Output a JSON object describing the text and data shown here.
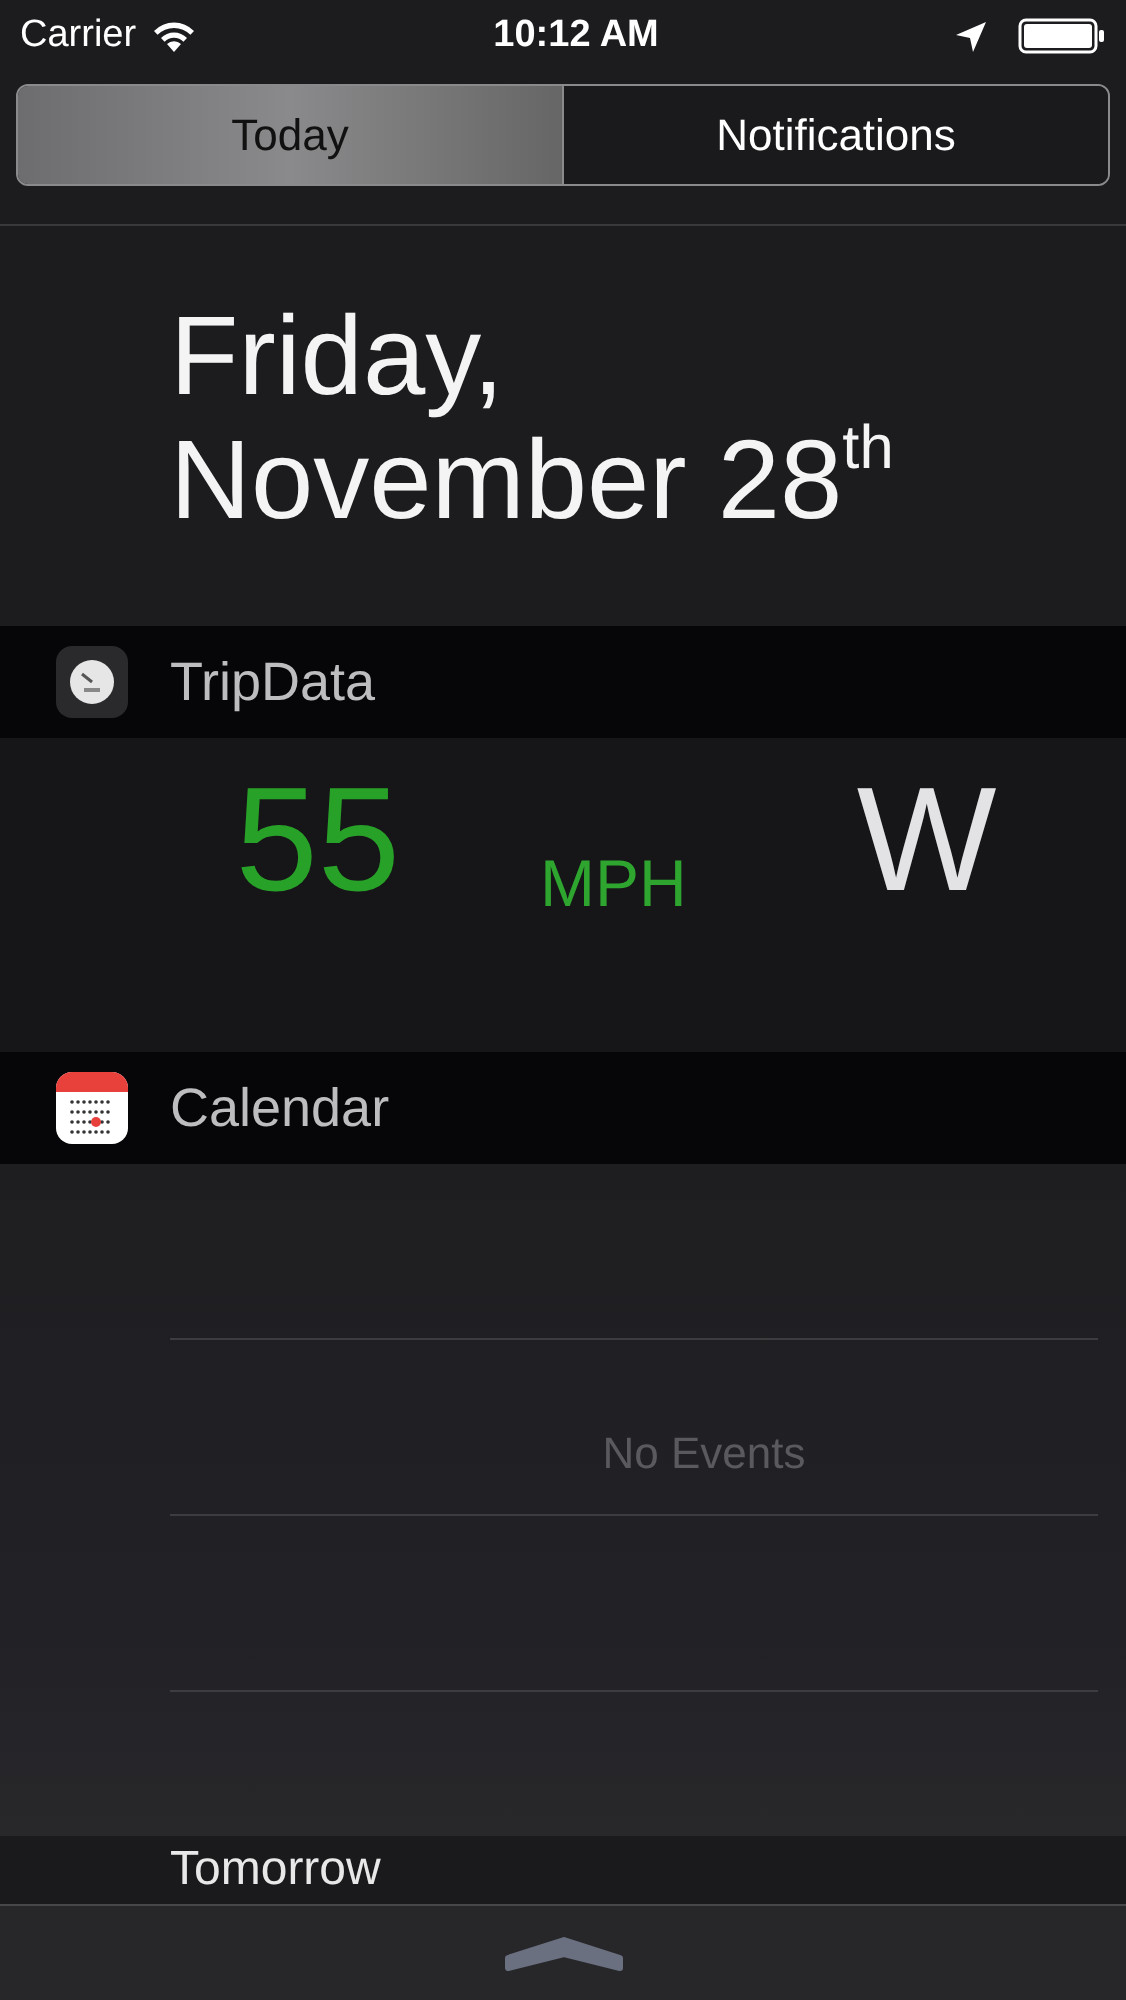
{
  "status_bar": {
    "carrier": "Carrier",
    "time": "10:12 AM"
  },
  "tabs": [
    {
      "label": "Today",
      "selected": true
    },
    {
      "label": "Notifications",
      "selected": false
    }
  ],
  "date": {
    "weekday": "Friday,",
    "day": "November 28$^{th}$"
  },
  "widgets": [
    {
      "kind": "tripdata",
      "title": "TripData",
      "speed": "55",
      "unit": "MPH",
      "heading": "W"
    },
    {
      "kind": "calendar",
      "title": "Calendar",
      "message": "No Events"
    }
  ],
  "next_section": {
    "title": "Tomorrow"
  }
}
